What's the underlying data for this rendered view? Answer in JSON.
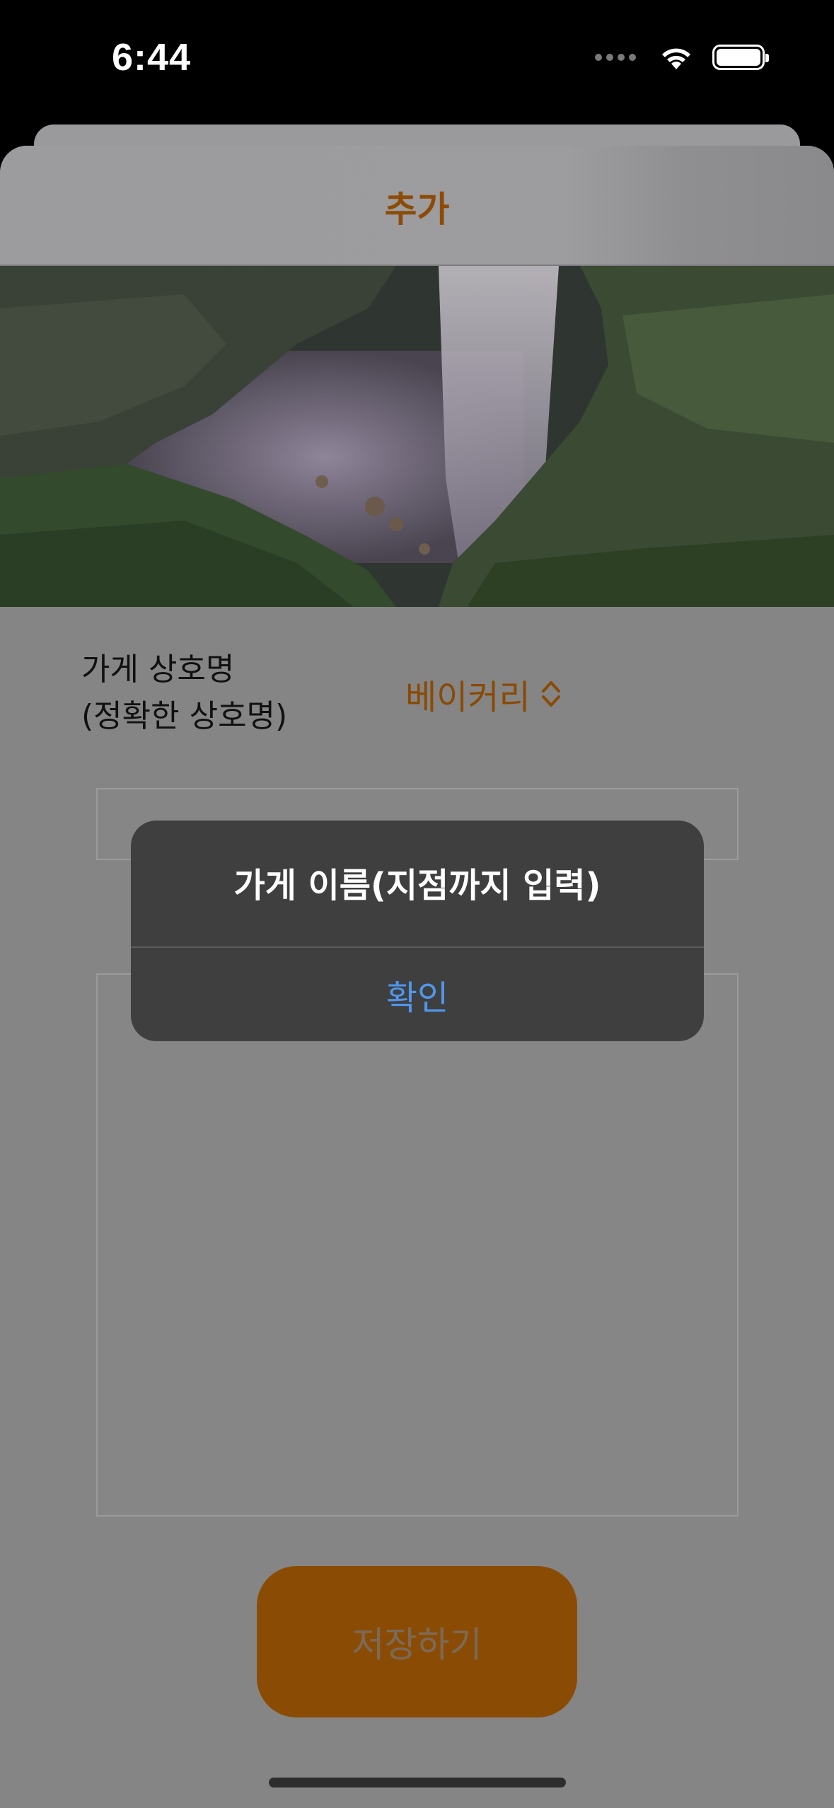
{
  "status_bar": {
    "time": "6:44",
    "icons": [
      "signal-dots-icon",
      "wifi-icon",
      "battery-icon"
    ]
  },
  "nav": {
    "title": "추가"
  },
  "hero_image": {
    "icon": "waterfall-photo"
  },
  "form": {
    "store_name_label_line1": "가게 상호명",
    "store_name_label_line2": "(정확한 상호명)",
    "category_picker_value": "베이커리",
    "save_button_label": "저장하기"
  },
  "alert": {
    "title": "가게 이름(지점까지 입력)",
    "confirm_label": "확인"
  },
  "colors": {
    "accent": "#8a4a05",
    "alert_button": "#4f96ec",
    "alert_background": "#3f3f3f"
  }
}
